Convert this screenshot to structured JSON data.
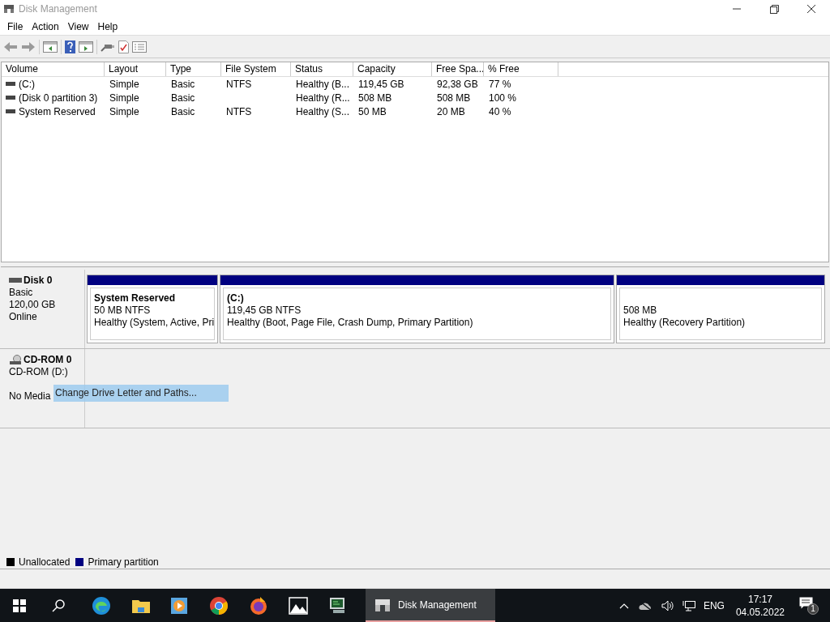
{
  "window": {
    "title": "Disk Management"
  },
  "menu": [
    "File",
    "Action",
    "View",
    "Help"
  ],
  "table": {
    "columns": [
      "Volume",
      "Layout",
      "Type",
      "File System",
      "Status",
      "Capacity",
      "Free Spa...",
      "% Free"
    ],
    "rows": [
      {
        "cells": [
          "(C:)",
          "Simple",
          "Basic",
          "NTFS",
          "Healthy (B...",
          "119,45 GB",
          "92,38 GB",
          "77 %"
        ]
      },
      {
        "cells": [
          "(Disk 0 partition 3)",
          "Simple",
          "Basic",
          "",
          "Healthy (R...",
          "508 MB",
          "508 MB",
          "100 %"
        ]
      },
      {
        "cells": [
          "System Reserved",
          "Simple",
          "Basic",
          "NTFS",
          "Healthy (S...",
          "50 MB",
          "20 MB",
          "40 %"
        ]
      }
    ]
  },
  "disks": [
    {
      "kind": "disk",
      "name": "Disk 0",
      "lines": [
        "Basic",
        "120,00 GB",
        "Online"
      ],
      "partitions": [
        {
          "name": "System Reserved",
          "size": "50 MB NTFS",
          "status": "Healthy (System, Active, Pri"
        },
        {
          "name": "(C:)",
          "size": "119,45 GB NTFS",
          "status": "Healthy (Boot, Page File, Crash Dump, Primary Partition)"
        },
        {
          "size": "508 MB",
          "status": "Healthy (Recovery Partition)"
        }
      ]
    },
    {
      "kind": "cdrom",
      "name": "CD-ROM 0",
      "lines": [
        "CD-ROM (D:)",
        "No Media"
      ]
    }
  ],
  "context_menu": {
    "items": [
      {
        "label": "Change Drive Letter and Paths...",
        "selected": true
      }
    ]
  },
  "legend": [
    {
      "label": "Unallocated",
      "color": "#000000"
    },
    {
      "label": "Primary partition",
      "color": "#000080"
    }
  ],
  "taskbar": {
    "active_app": "Disk Management",
    "language": "ENG",
    "time": "17:17",
    "date": "04.05.2022",
    "notifications": "1"
  }
}
